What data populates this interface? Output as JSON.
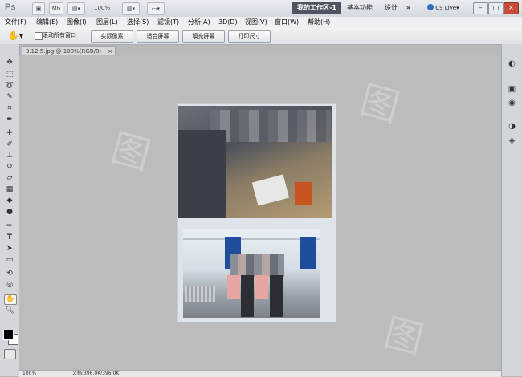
{
  "app": {
    "logo": "Ps",
    "toolbar": {
      "mb_label": "Mb",
      "zoom": "100%"
    },
    "workspace_active": "我的工作区-1",
    "workspaces": [
      "基本功能",
      "设计"
    ],
    "overflow": "»",
    "cs_live": "CS Live",
    "window_buttons": [
      "–",
      "□",
      "×"
    ]
  },
  "menubar": {
    "items": [
      "文件(F)",
      "编辑(E)",
      "图像(I)",
      "图层(L)",
      "选择(S)",
      "滤镜(T)",
      "分析(A)",
      "3D(D)",
      "视图(V)",
      "窗口(W)",
      "帮助(H)"
    ]
  },
  "options": {
    "scroll_all_label": "滚动所有窗口",
    "buttons": [
      "实际像素",
      "适合屏幕",
      "填充屏幕",
      "打印尺寸"
    ]
  },
  "document": {
    "tab_title": "3.12.5.jpg @ 100%(RGB/8)",
    "tab_close": "×"
  },
  "statusbar": {
    "zoom": "100%",
    "doc_info": "文档:396.0K/396.0K"
  },
  "tools": [
    "move-icon",
    "marquee-icon",
    "lasso-icon",
    "quick-select-icon",
    "crop-icon",
    "eyedropper-icon",
    "healing-icon",
    "brush-icon",
    "stamp-icon",
    "history-brush-icon",
    "eraser-icon",
    "gradient-icon",
    "blur-icon",
    "dodge-icon",
    "pen-icon",
    "type-icon",
    "path-select-icon",
    "shape-icon",
    "3d-rotate-icon",
    "3d-orbit-icon",
    "hand-icon",
    "zoom-icon"
  ],
  "right_panel": [
    "color-panel-icon",
    "adjust-panel-icon",
    "layers-icon",
    "channels-icon",
    "paths-icon"
  ],
  "colors": {
    "foreground": "#000000",
    "background": "#ffffff",
    "workspace_active_bg": "#4e5561"
  }
}
